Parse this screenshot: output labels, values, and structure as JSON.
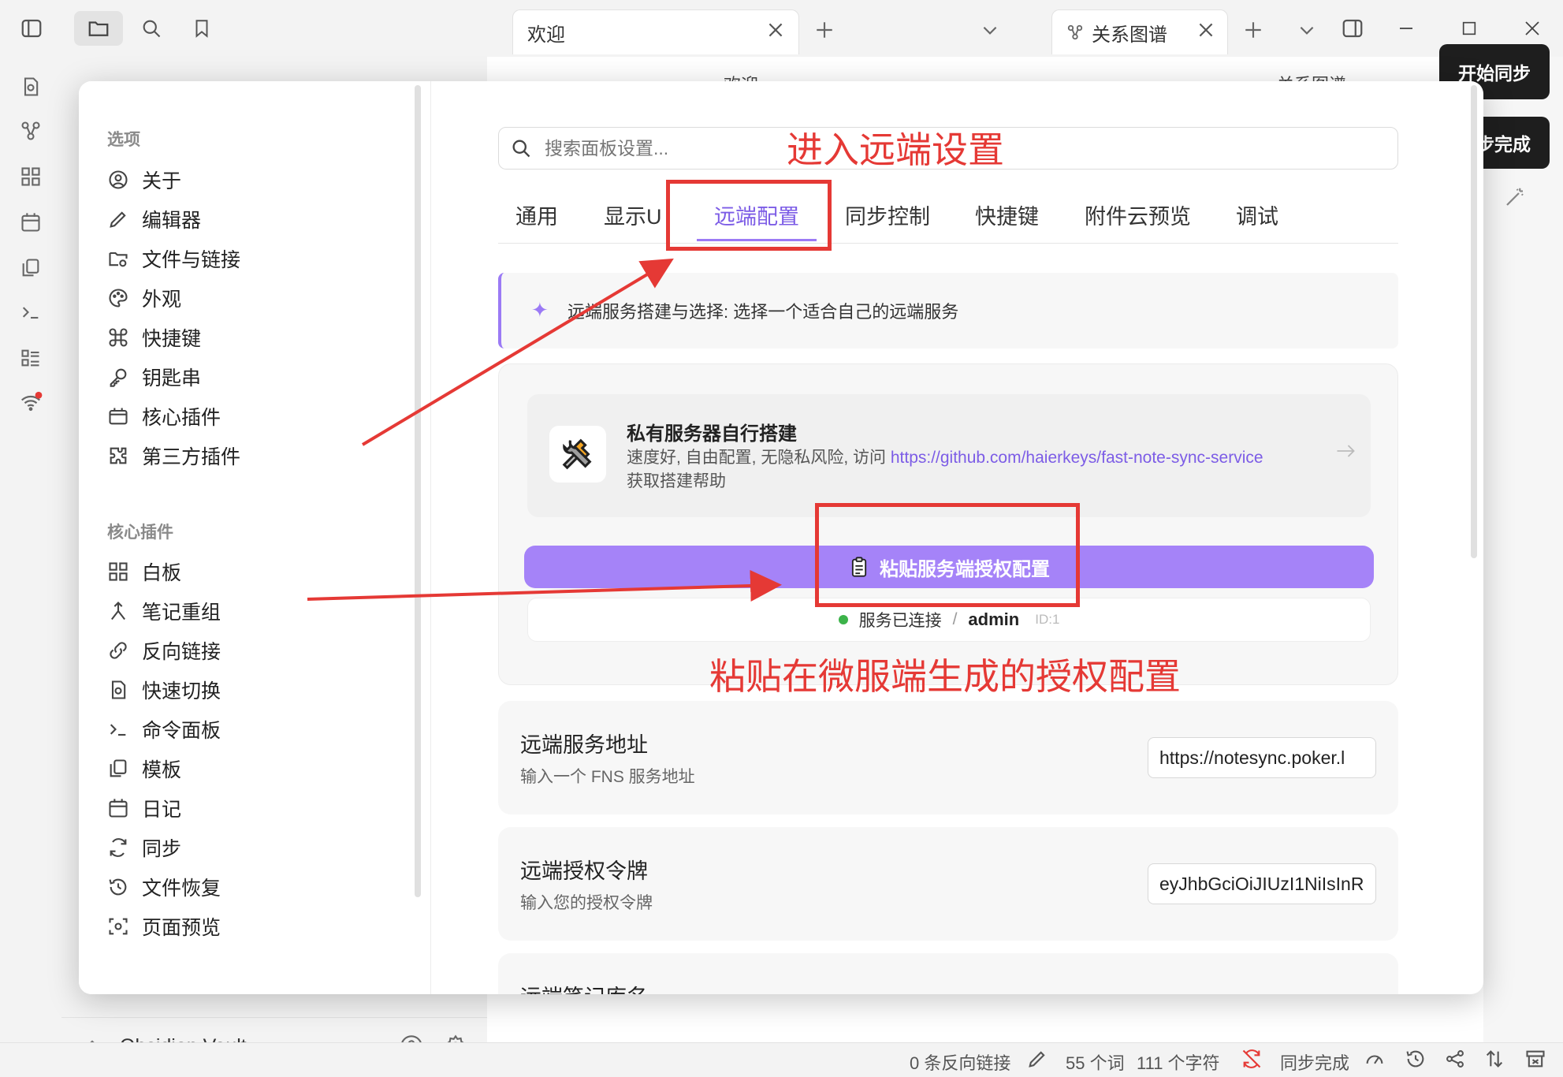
{
  "topbar": {
    "tab_welcome": "欢迎",
    "tab_graph": "关系图谱",
    "pane_title_welcome": "欢迎",
    "pane_title_graph": "关系图谱"
  },
  "notifications": {
    "start_sync": "开始同步",
    "sync_done": "同步完成"
  },
  "settings_nav": {
    "options_header": "选项",
    "options": [
      "关于",
      "编辑器",
      "文件与链接",
      "外观",
      "快捷键",
      "钥匙串",
      "核心插件",
      "第三方插件"
    ],
    "core_header": "核心插件",
    "core": [
      "白板",
      "笔记重组",
      "反向链接",
      "快速切换",
      "命令面板",
      "模板",
      "日记",
      "同步",
      "文件恢复",
      "页面预览"
    ]
  },
  "plugin_settings": {
    "search_placeholder": "搜索面板设置...",
    "tabs": [
      "通用",
      "显示UI",
      "远端配置",
      "同步控制",
      "快捷键",
      "附件云预览",
      "调试"
    ],
    "active_tab_index": 2,
    "notice": "远端服务搭建与选择: 选择一个适合自己的远端服务",
    "server_card": {
      "title": "私有服务器自行搭建",
      "desc_before": "速度好, 自由配置, 无隐私风险, 访问 ",
      "link": "https://github.com/haierkeys/fast-note-sync-service",
      "desc_after": " 获取搭建帮助"
    },
    "paste_button": "粘贴服务端授权配置",
    "connection": {
      "status": "服务已连接",
      "separator": "/",
      "user": "admin",
      "id": "ID:1"
    },
    "fields": [
      {
        "title": "远端服务地址",
        "desc": "输入一个 FNS 服务地址",
        "value": "https://notesync.poker.l"
      },
      {
        "title": "远端授权令牌",
        "desc": "输入您的授权令牌",
        "value": "eyJhbGciOiJIUzI1NiIsInR"
      },
      {
        "title": "远端笔记库名",
        "desc": "",
        "value": ""
      }
    ]
  },
  "annotations": {
    "enter_remote": "进入远端设置",
    "paste_hint": "粘贴在微服端生成的授权配置"
  },
  "vault": {
    "name": "Obsidian Vault"
  },
  "statusbar": {
    "backlinks": "0 条反向链接",
    "words": "55 个词",
    "chars": "111 个字符",
    "sync": "同步完成"
  },
  "colors": {
    "accent": "#9b7af5",
    "accent_text": "#7c5ce6",
    "annotation_red": "#e53935",
    "connected_green": "#3cb34a"
  }
}
